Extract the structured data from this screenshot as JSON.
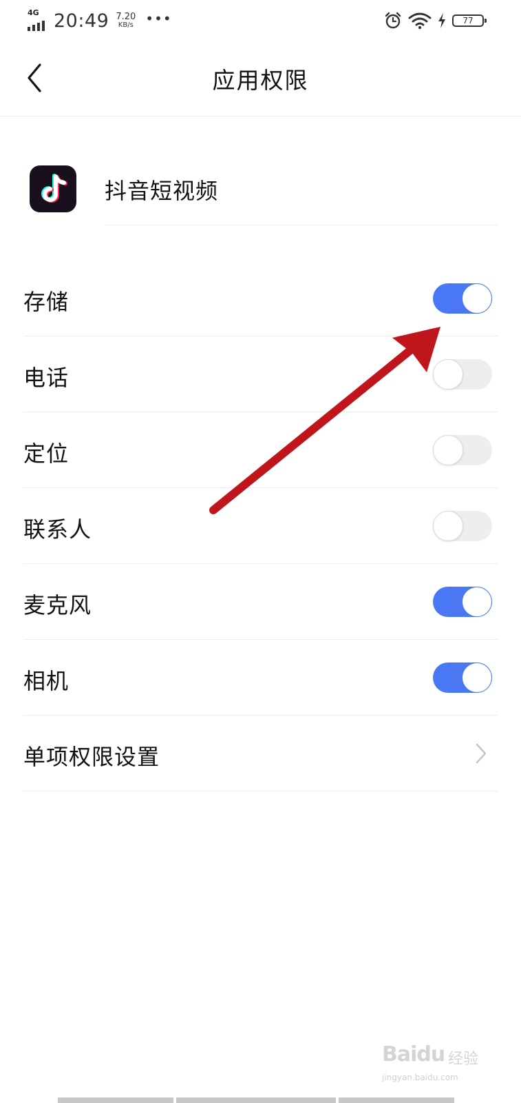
{
  "status_bar": {
    "network": "4G",
    "time": "20:49",
    "speed_value": "7.20",
    "speed_unit": "KB/s",
    "more": "•••",
    "battery": "77"
  },
  "header": {
    "title": "应用权限",
    "back_icon": "chevron-left-icon"
  },
  "app": {
    "name": "抖音短视频",
    "icon": "tiktok-logo-icon"
  },
  "permissions": [
    {
      "label": "存储",
      "enabled": true
    },
    {
      "label": "电话",
      "enabled": false
    },
    {
      "label": "定位",
      "enabled": false
    },
    {
      "label": "联系人",
      "enabled": false
    },
    {
      "label": "麦克风",
      "enabled": true
    },
    {
      "label": "相机",
      "enabled": true
    }
  ],
  "individual_settings": {
    "label": "单项权限设置",
    "icon": "chevron-right-icon"
  },
  "watermark": {
    "brand": "Baidu",
    "suffix": "经验",
    "url": "jingyan.baidu.com"
  },
  "colors": {
    "switch_on": "#4a78f5",
    "switch_off": "#eeeeee",
    "annotation_arrow": "#c0161b"
  }
}
